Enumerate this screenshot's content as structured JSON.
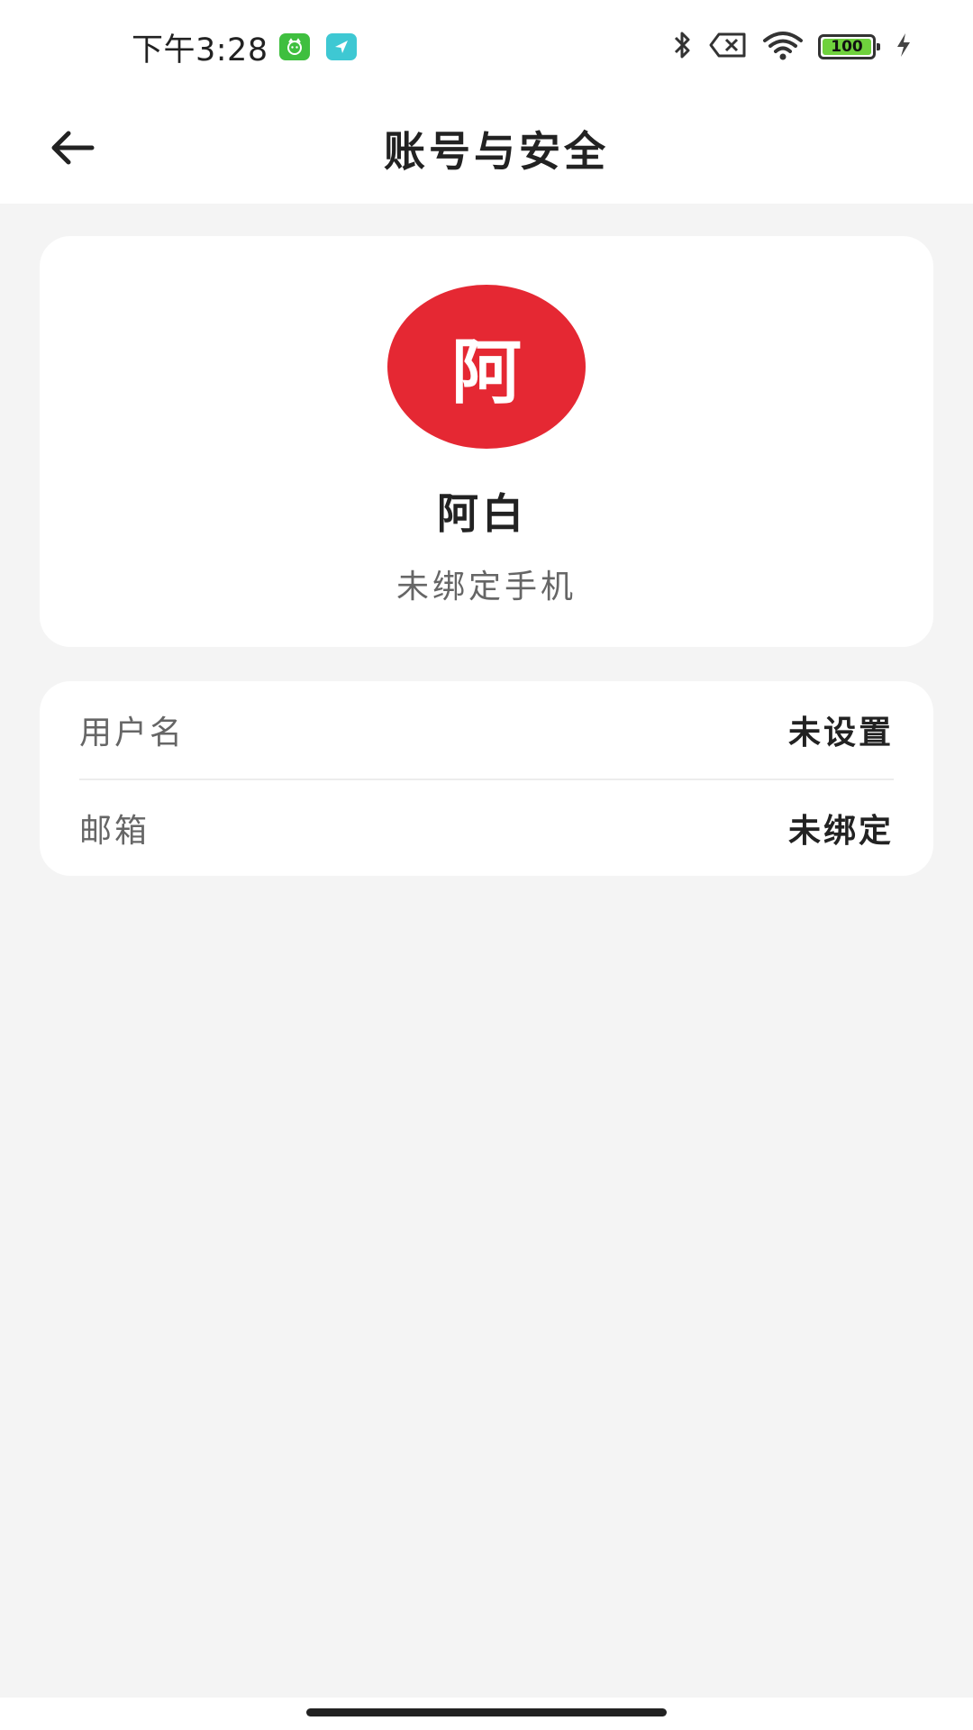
{
  "status_bar": {
    "time": "下午3:28",
    "battery": "100",
    "battery_level": 1.0,
    "icons": [
      "app-green-icon",
      "app-teal-icon",
      "bluetooth-icon",
      "no-sim-icon",
      "wifi-icon",
      "battery-icon",
      "charging-icon"
    ]
  },
  "header": {
    "title": "账号与安全",
    "back_icon": "arrow-left-icon"
  },
  "profile": {
    "avatar_text": "阿",
    "avatar_color": "#e52833",
    "name": "阿白",
    "phone_status": "未绑定手机"
  },
  "info_list": [
    {
      "label": "用户名",
      "value": "未设置"
    },
    {
      "label": "邮箱",
      "value": "未绑定"
    }
  ],
  "colors": {
    "background": "#f4f4f4",
    "card": "#ffffff",
    "accent": "#e52833"
  }
}
